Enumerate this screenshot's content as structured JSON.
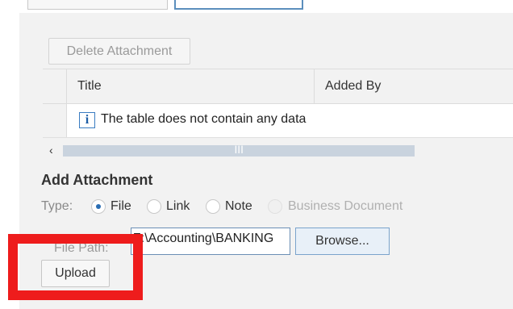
{
  "toolbar": {
    "delete_label": "Delete Attachment"
  },
  "table": {
    "columns": [
      "Title",
      "Added By"
    ],
    "empty_message": "The table does not contain any data",
    "info_icon": "i"
  },
  "scrollbar": {
    "left_arrow": "‹",
    "grip": "|||"
  },
  "add_attachment": {
    "title": "Add Attachment",
    "type_label": "Type:",
    "types": [
      {
        "label": "File",
        "checked": true,
        "disabled": false
      },
      {
        "label": "Link",
        "checked": false,
        "disabled": false
      },
      {
        "label": "Note",
        "checked": false,
        "disabled": false
      },
      {
        "label": "Business Document",
        "checked": false,
        "disabled": true
      }
    ],
    "file_path_label": "File Path:",
    "file_path_value": "Z:\\Accounting\\BANKING",
    "browse_label": "Browse...",
    "upload_label": "Upload"
  },
  "annotation": {
    "color": "#ee1c1c"
  }
}
